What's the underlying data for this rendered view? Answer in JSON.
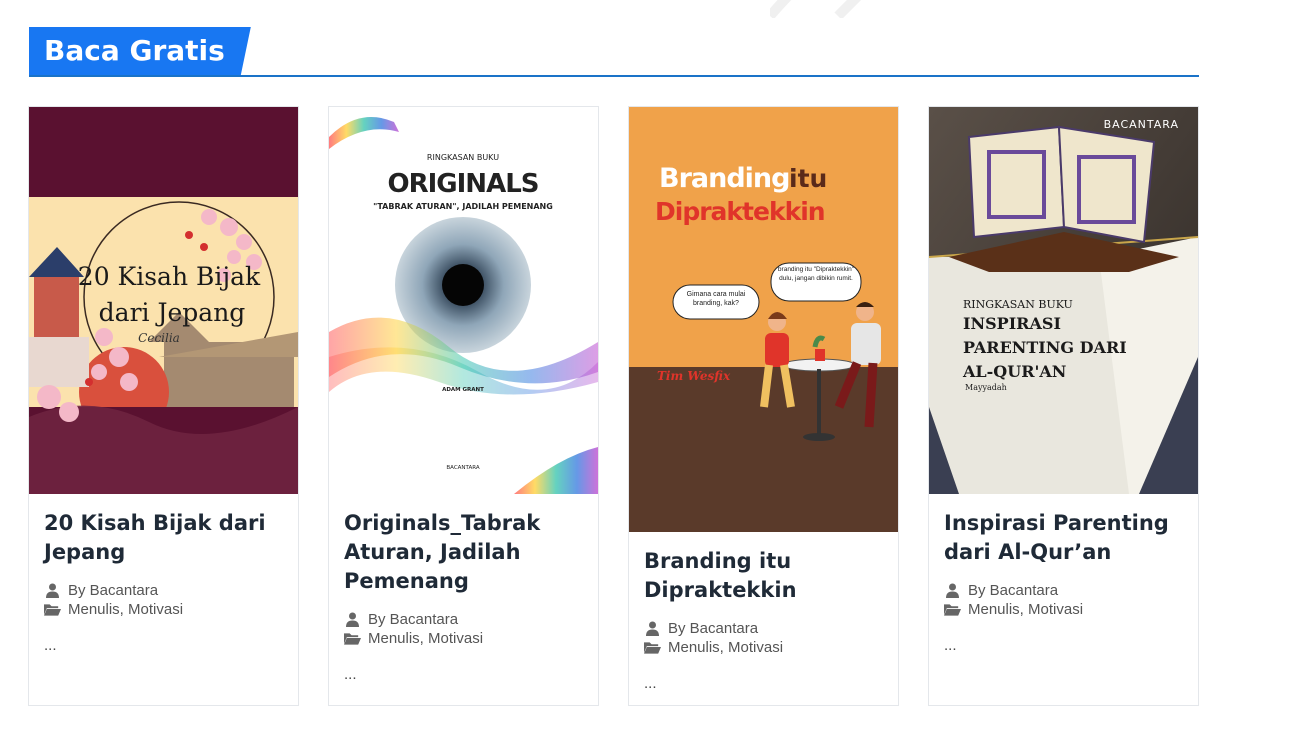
{
  "section": {
    "title": "Baca Gratis",
    "accent": "#1877f2",
    "rule_color": "#1a73c8"
  },
  "cards": [
    {
      "title": "20 Kisah Bijak dari Jepang",
      "author": "By Bacantara",
      "categories": "Menulis, Motivasi",
      "excerpt": "...",
      "cover": {
        "line1": "20 Kisah Bijak",
        "line2": "dari Jepang",
        "author": "Cecilia"
      }
    },
    {
      "title": "Originals_Tabrak Aturan, Jadilah Pemenang",
      "author": "By Bacantara",
      "categories": "Menulis, Motivasi",
      "excerpt": "...",
      "cover": {
        "kicker": "RINGKASAN BUKU",
        "title": "ORIGINALS",
        "subtitle": "\"TABRAK ATURAN\", JADILAH PEMENANG",
        "author": "ADAM GRANT",
        "brand": "BACANTARA"
      }
    },
    {
      "title": "Branding itu Dipraktekkin",
      "author": "By Bacantara",
      "categories": "Menulis, Motivasi",
      "excerpt": "...",
      "cover": {
        "word1": "Branding",
        "word2": "itu",
        "word3": "Dipraktekkin",
        "bubble_left": "Gimana cara mulai branding, kak?",
        "bubble_right": "branding itu \"Dipraktekkin\" dulu, jangan dibikin rumit.",
        "team": "Tim Wesfix"
      }
    },
    {
      "title": "Inspirasi Parenting dari Al-Qur’an",
      "author": "By Bacantara",
      "categories": "Menulis, Motivasi",
      "excerpt": "...",
      "cover": {
        "brand": "BACANTARA",
        "kicker": "RINGKASAN BUKU",
        "line1": "INSPIRASI",
        "line2": "PARENTING DARI",
        "line3": "AL-QUR'AN",
        "author": "Mayyadah"
      }
    }
  ]
}
